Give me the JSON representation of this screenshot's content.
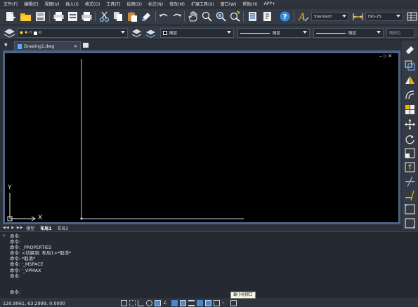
{
  "menu": [
    "文件(F)",
    "编辑(E)",
    "视图(V)",
    "插入(I)",
    "格式(O)",
    "工具(T)",
    "绘图(D)",
    "标注(N)",
    "修改(M)",
    "扩展工具(X)",
    "窗口(W)",
    "帮助(H)",
    "APP+"
  ],
  "toolbar1": {
    "text_style": "Standard",
    "dim_style": "ISO-25"
  },
  "toolbar2": {
    "layer_value": "0",
    "color_value": "随层",
    "linetype_value": "随层",
    "lineweight_value": "随层",
    "plotstyle_value": "随颜色"
  },
  "document": {
    "tab_title": "Drawing1.dwg"
  },
  "ucs": {
    "x_label": "X",
    "y_label": "Y"
  },
  "layout_tabs": [
    "模型",
    "布局1",
    "布局2"
  ],
  "command": {
    "history": [
      "命令:",
      "命令:",
      "命令: _PROPERTIES",
      "命令: <切换到: 布局1>*取消*",
      "命令: *取消*",
      "命令: '_MSPACE",
      "命令: '_VPMAX",
      "命令:"
    ],
    "prompt": "命令:"
  },
  "status": {
    "coordinates": "120.9961, 63.2999, 0.0000",
    "tooltip": "最小化视口"
  }
}
